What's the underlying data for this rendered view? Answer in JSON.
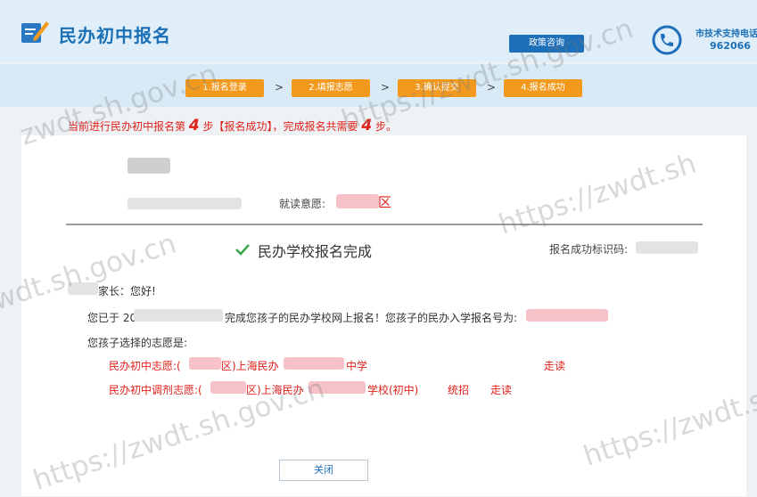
{
  "header": {
    "app_title": "民办初中报名",
    "policy_button": "政策咨询",
    "support_label": "市技术支持电话",
    "support_number": "962066"
  },
  "steps": [
    {
      "label": "1.报名登录"
    },
    {
      "label": "2.填报志愿"
    },
    {
      "label": "3.确认提交"
    },
    {
      "label": "4.报名成功"
    }
  ],
  "step_arrows": [
    ">",
    ">",
    ">"
  ],
  "notice": {
    "prefix": "当前进行民办初中报名第",
    "step": "4",
    "middle": "步【报名成功】，完成报名共需要",
    "total": "4",
    "suffix": "步。"
  },
  "card": {
    "intent_label": "就读意愿:",
    "intent_district_suffix": "区",
    "completion_title": "民办学校报名完成",
    "code_label": "报名成功标识码:",
    "greeting": "家长：您好!",
    "line1_prefix": "您已于 20",
    "line1_middle": "完成您孩子的民办学校网上报名！您孩子的民办入学报名号为:",
    "choice_intro": "您孩子选择的志愿是:",
    "choice1_label": "民办初中志愿:(",
    "choice1_district": "区)上海民办",
    "choice1_school_suffix": "中学",
    "choice1_type": "走读",
    "choice2_label": "民办初中调剂志愿:(",
    "choice2_district": "区)上海民办",
    "choice2_school_suffix": "学校(初中)",
    "choice2_plan": "统招",
    "choice2_type": "走读",
    "close_button": "关闭"
  },
  "watermarks": [
    "zwdt.sh.gov.cn",
    "https://zwdt.sh.gov.cn",
    "https://zwdt.sh.gov.cn",
    "https://zwdt.sh",
    "zwdt.sh.gov.cn",
    "https://zwdt.sh.gov.cn",
    "https://zwdt.sh"
  ],
  "colors": {
    "brand_blue": "#1b6fb6",
    "step_orange": "#f39a1e",
    "alert_red": "#e0211b"
  }
}
